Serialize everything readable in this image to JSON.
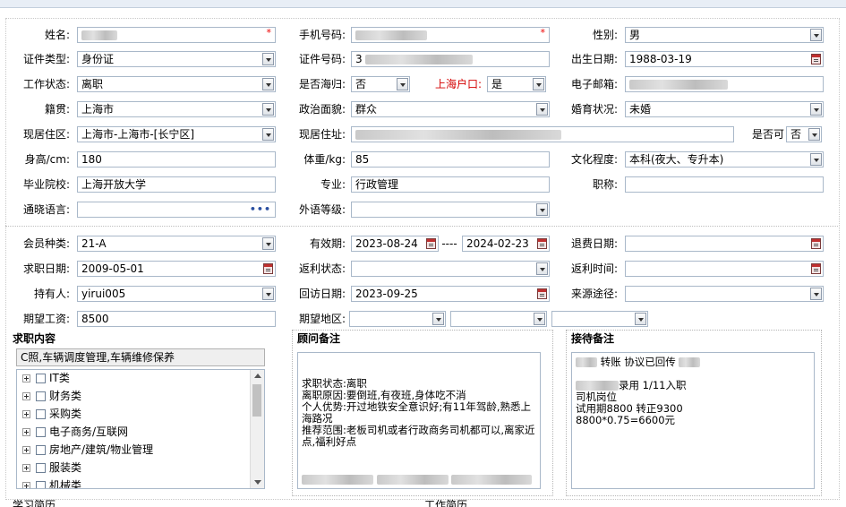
{
  "form": {
    "name": {
      "label": "姓名:",
      "required": "*"
    },
    "phone": {
      "label": "手机号码:",
      "required": "*"
    },
    "gender": {
      "label": "性别:",
      "value": "男"
    },
    "id_type": {
      "label": "证件类型:",
      "value": "身份证"
    },
    "id_number": {
      "label": "证件号码:",
      "value": "3"
    },
    "birth_date": {
      "label": "出生日期:",
      "value": "1988-03-19"
    },
    "work_status": {
      "label": "工作状态:",
      "value": "离职"
    },
    "returnee": {
      "label": "是否海归:",
      "value": "否"
    },
    "shanghai_hukou": {
      "label": "上海户口:",
      "value": "是"
    },
    "email": {
      "label": "电子邮箱:"
    },
    "native_place": {
      "label": "籍贯:",
      "value": "上海市"
    },
    "political": {
      "label": "政治面貌:",
      "value": "群众"
    },
    "marital": {
      "label": "婚育状况:",
      "value": "未婚"
    },
    "residence_area": {
      "label": "现居住区:",
      "value": "上海市-上海市-[长宁区]"
    },
    "residence_addr": {
      "label": "现居住址:"
    },
    "is_available": {
      "label": "是否可",
      "value": "否"
    },
    "height": {
      "label": "身高/cm:",
      "value": "180"
    },
    "weight": {
      "label": "体重/kg:",
      "value": "85"
    },
    "education": {
      "label": "文化程度:",
      "value": "本科(夜大、专升本)"
    },
    "school": {
      "label": "毕业院校:",
      "value": "上海开放大学"
    },
    "major": {
      "label": "专业:",
      "value": "行政管理"
    },
    "title": {
      "label": "职称:",
      "value": ""
    },
    "languages": {
      "label": "通晓语言:",
      "value": ""
    },
    "foreign_level": {
      "label": "外语等级:",
      "value": ""
    },
    "member_type": {
      "label": "会员种类:",
      "value": "21-A"
    },
    "valid_period": {
      "label": "有效期:",
      "from": "2023-08-24",
      "sep": "----",
      "to": "2024-02-23"
    },
    "refund_date": {
      "label": "退费日期:",
      "value": ""
    },
    "job_seek_date": {
      "label": "求职日期:",
      "value": "2009-05-01"
    },
    "rebate_status": {
      "label": "返利状态:",
      "value": ""
    },
    "rebate_time": {
      "label": "返利时间:",
      "value": ""
    },
    "holder": {
      "label": "持有人:",
      "value": "yirui005"
    },
    "visit_date": {
      "label": "回访日期:",
      "value": "2023-09-25"
    },
    "source": {
      "label": "来源途径:",
      "value": ""
    },
    "expected_salary": {
      "label": "期望工资:",
      "value": "8500"
    },
    "expected_region": {
      "label": "期望地区:"
    }
  },
  "job_content": {
    "header": "求职内容",
    "selected": "C照,车辆调度管理,车辆维修保养",
    "tree": [
      "IT类",
      "财务类",
      "采购类",
      "电子商务/互联网",
      "房地产/建筑/物业管理",
      "服装类",
      "机械类"
    ]
  },
  "advisor_notes": {
    "header": "顾问备注",
    "text": "求职状态:离职\n离职原因:要倒班,有夜班,身体吃不消\n个人优势:开过地铁安全意识好;有11年驾龄,熟悉上海路况\n推荐范围:老板司机或者行政商务司机都可以,离家近点,福利好点"
  },
  "reception_notes": {
    "header": "接待备注",
    "line1": "转账 协议已回传",
    "line2": "录用  1/11入职",
    "line3": "司机岗位",
    "line4": "试用期8800 转正9300",
    "line5": "8800*0.75=6600元"
  },
  "bottom": {
    "left": "学习简历",
    "right": "工作简历"
  }
}
